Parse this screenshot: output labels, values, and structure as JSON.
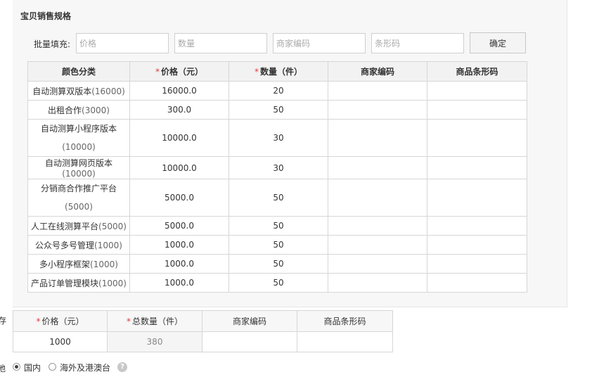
{
  "section": {
    "title": "宝贝销售规格"
  },
  "batch": {
    "label": "批量填充:",
    "price_placeholder": "价格",
    "quantity_placeholder": "数量",
    "merchant_code_placeholder": "商家编码",
    "barcode_placeholder": "条形码",
    "confirm_label": "确定"
  },
  "sku_table": {
    "headers": {
      "color": "颜色分类",
      "price_required": "*",
      "price": "价格（元）",
      "quantity_required": "*",
      "quantity": "数量（件）",
      "merchant_code": "商家编码",
      "barcode": "商品条形码"
    },
    "rows": [
      {
        "name": "自动测算双版本",
        "name_price": "(16000)",
        "price": "16000.0",
        "quantity": "20"
      },
      {
        "name": "出租合作",
        "name_price": "(3000)",
        "price": "300.0",
        "quantity": "50"
      },
      {
        "name": "自动测算小程序版本",
        "name_price": "(10000)",
        "price": "10000.0",
        "quantity": "30"
      },
      {
        "name": "自动测算网页版本",
        "name_price": "(10000)",
        "price": "10000.0",
        "quantity": "30"
      },
      {
        "name": "分销商合作推广平台",
        "name_price": "(5000)",
        "price": "5000.0",
        "quantity": "50"
      },
      {
        "name": "人工在线测算平台",
        "name_price": "(5000)",
        "price": "5000.0",
        "quantity": "50"
      },
      {
        "name": "公众号多号管理",
        "name_price": "(1000)",
        "price": "1000.0",
        "quantity": "50"
      },
      {
        "name": "多小程序框架",
        "name_price": "(1000)",
        "price": "1000.0",
        "quantity": "50"
      },
      {
        "name": "产品订单管理模块",
        "name_price": "(1000)",
        "price": "1000.0",
        "quantity": "50"
      }
    ]
  },
  "stock": {
    "label": "存",
    "headers": {
      "price_required": "*",
      "price": "价格（元）",
      "total_required": "*",
      "total": "总数量（件）",
      "merchant_code": "商家编码",
      "barcode": "商品条形码"
    },
    "price_value": "1000",
    "total_value": "380"
  },
  "location": {
    "label": "地",
    "options": [
      "国内",
      "海外及港澳台"
    ],
    "selected": "国内",
    "help_glyph": "?"
  },
  "colors": {
    "required": "#e4393c",
    "panel_bg": "#f7f7f7",
    "border": "#d6d6d6"
  }
}
